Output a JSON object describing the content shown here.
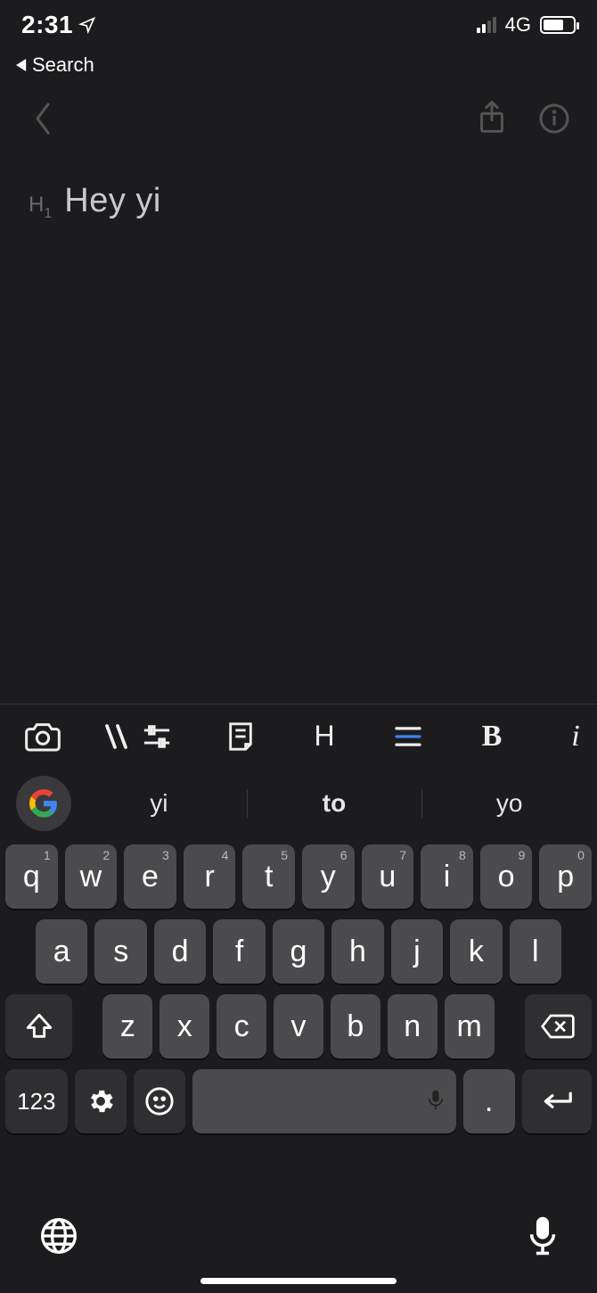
{
  "status": {
    "time": "2:31",
    "network": "4G",
    "battery_pct": 70,
    "signal_bars_on": 2,
    "return_label": "Search"
  },
  "editor": {
    "heading_marker": "H",
    "heading_level": "1",
    "text": "Hey yi"
  },
  "toolbar": {
    "heading_label": "H",
    "bold_label": "B",
    "italic_label": "i"
  },
  "suggestions": {
    "left": "yi",
    "center": "to",
    "right": "yo"
  },
  "keyboard": {
    "row1": [
      {
        "k": "q",
        "n": "1"
      },
      {
        "k": "w",
        "n": "2"
      },
      {
        "k": "e",
        "n": "3"
      },
      {
        "k": "r",
        "n": "4"
      },
      {
        "k": "t",
        "n": "5"
      },
      {
        "k": "y",
        "n": "6"
      },
      {
        "k": "u",
        "n": "7"
      },
      {
        "k": "i",
        "n": "8"
      },
      {
        "k": "o",
        "n": "9"
      },
      {
        "k": "p",
        "n": "0"
      }
    ],
    "row2": [
      "a",
      "s",
      "d",
      "f",
      "g",
      "h",
      "j",
      "k",
      "l"
    ],
    "row3": [
      "z",
      "x",
      "c",
      "v",
      "b",
      "n",
      "m"
    ],
    "numeric_label": "123",
    "period_label": "."
  }
}
